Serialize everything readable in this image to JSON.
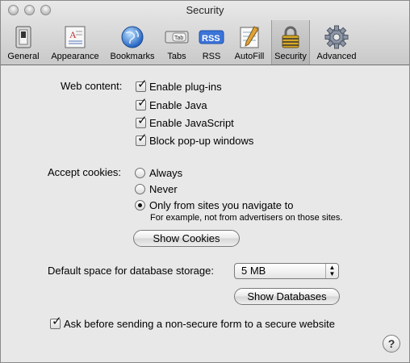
{
  "window": {
    "title": "Security"
  },
  "toolbar": {
    "items": [
      {
        "label": "General",
        "icon": "general-switch-icon"
      },
      {
        "label": "Appearance",
        "icon": "appearance-icon"
      },
      {
        "label": "Bookmarks",
        "icon": "globe-icon"
      },
      {
        "label": "Tabs",
        "icon": "tabs-icon",
        "icon_text": "Tab"
      },
      {
        "label": "RSS",
        "icon": "rss-icon",
        "icon_text": "RSS"
      },
      {
        "label": "AutoFill",
        "icon": "autofill-pencil-icon"
      },
      {
        "label": "Security",
        "icon": "padlock-icon",
        "selected": true
      },
      {
        "label": "Advanced",
        "icon": "gear-icon"
      }
    ]
  },
  "web_content": {
    "label": "Web content:",
    "options": [
      {
        "label": "Enable plug-ins",
        "checked": true
      },
      {
        "label": "Enable Java",
        "checked": true
      },
      {
        "label": "Enable JavaScript",
        "checked": true
      },
      {
        "label": "Block pop-up windows",
        "checked": true
      }
    ]
  },
  "cookies": {
    "label": "Accept cookies:",
    "options": [
      {
        "label": "Always",
        "selected": false
      },
      {
        "label": "Never",
        "selected": false
      },
      {
        "label": "Only from sites you navigate to",
        "selected": true
      }
    ],
    "note": "For example, not from advertisers on those sites.",
    "show_button": "Show Cookies"
  },
  "database": {
    "label": "Default space for database storage:",
    "value": "5 MB",
    "show_button": "Show Databases"
  },
  "ask_nonsecure": {
    "label": "Ask before sending a non-secure form to a secure website",
    "checked": true
  },
  "help": {
    "label": "?"
  },
  "colors": {
    "window_bg": "#e8e8e8",
    "toolbar_top": "#e9e9e9",
    "toolbar_bottom": "#c9c9c9"
  }
}
